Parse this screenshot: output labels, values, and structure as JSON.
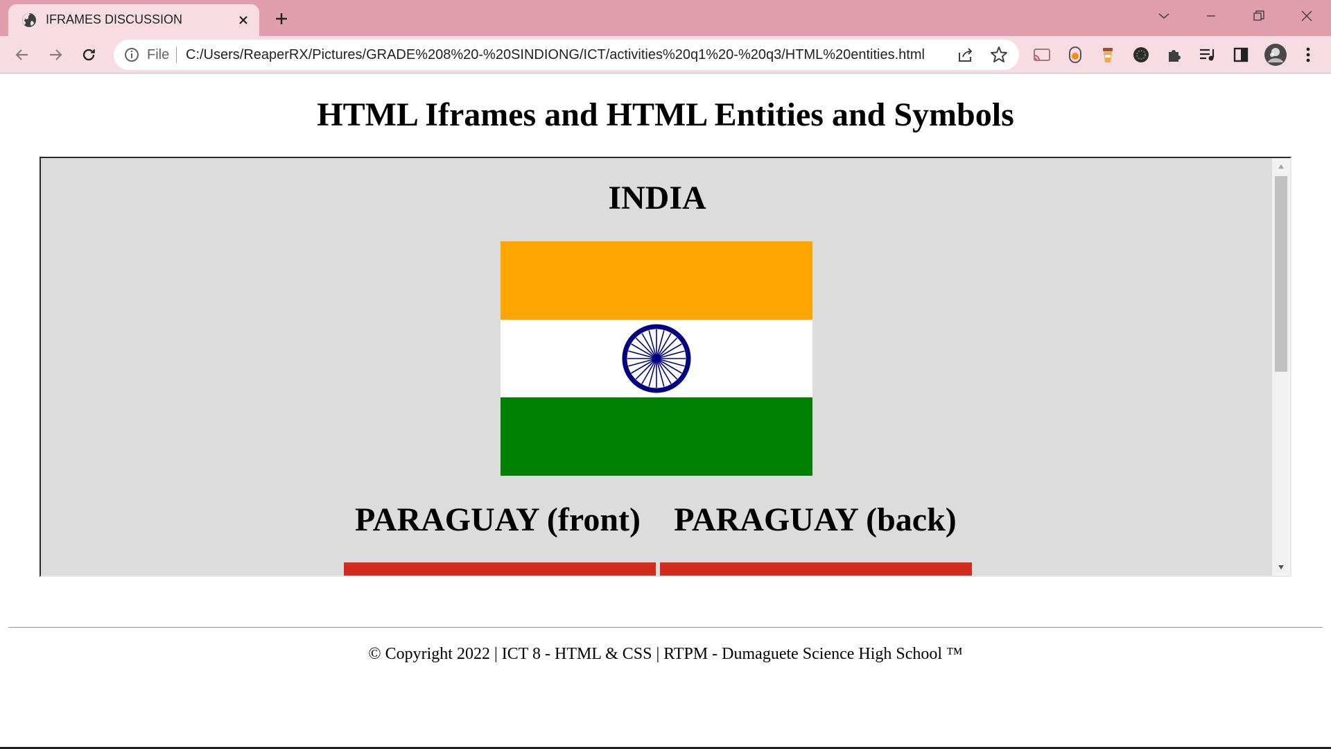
{
  "browser": {
    "tab": {
      "title": "IFRAMES DISCUSSION",
      "favicon": "globe-icon"
    },
    "address_bar": {
      "scheme_label": "File",
      "url": "C:/Users/ReaperRX/Pictures/GRADE%208%20-%20SINDIONG/ICT/activities%20q1%20-%20q3/HTML%20entities.html"
    },
    "colors": {
      "frame": "#e09dab",
      "toolbar": "#f7dde3"
    },
    "extensions": [
      "cast-icon",
      "extension-orange-icon",
      "extension-cup-icon",
      "extension-dark-icon",
      "puzzle-icon",
      "reading-list-icon",
      "side-panel-icon",
      "profile-avatar"
    ]
  },
  "page": {
    "title": "HTML Iframes and HTML Entities and Symbols",
    "iframe": {
      "background": "#dcdcdc",
      "india_heading": "INDIA",
      "paraguay_front_heading": "PARAGUAY (front)",
      "paraguay_back_heading": "PARAGUAY (back)",
      "india_flag_colors": {
        "saffron": "#ffa500",
        "white": "#ffffff",
        "green": "#008000",
        "chakra": "#000080"
      },
      "paraguay_flag_red": "#d52b1e"
    },
    "footer": "© Copyright 2022 | ICT 8 - HTML & CSS | RTPM - Dumaguete Science High School ™"
  }
}
